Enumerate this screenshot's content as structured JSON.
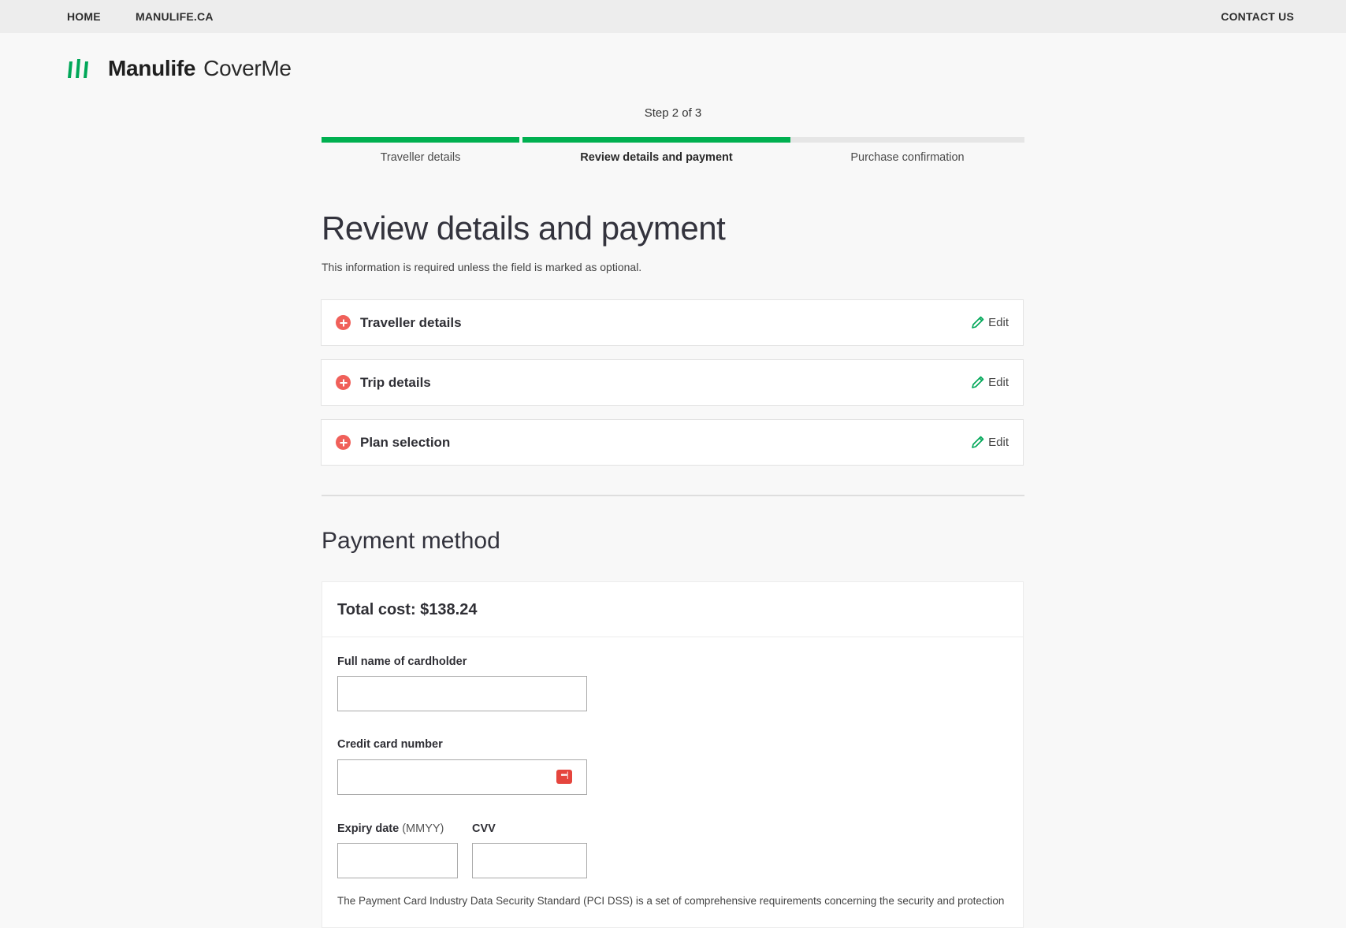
{
  "nav": {
    "home": "HOME",
    "manulife": "MANULIFE.CA",
    "contact": "CONTACT US"
  },
  "logo": {
    "brand": "Manulife",
    "product": "CoverMe",
    "icon": "manulife-logo-icon",
    "color": "#00a758"
  },
  "stepper": {
    "count": "Step 2 of 3",
    "steps": [
      {
        "label": "Traveller details",
        "status": "complete"
      },
      {
        "label": "Review details and payment",
        "status": "current"
      },
      {
        "label": "Purchase confirmation",
        "status": "upcoming"
      }
    ],
    "active_color": "#00b050"
  },
  "page": {
    "title": "Review details and payment",
    "subtitle": "This information is required unless the field is marked as optional."
  },
  "sections": [
    {
      "title": "Traveller details",
      "edit": "Edit",
      "icon": "plus-circle-icon"
    },
    {
      "title": "Trip details",
      "edit": "Edit",
      "icon": "plus-circle-icon"
    },
    {
      "title": "Plan selection",
      "edit": "Edit",
      "icon": "plus-circle-icon"
    }
  ],
  "payment": {
    "title": "Payment method",
    "total": "Total cost: $138.24",
    "cardholder_label": "Full name of cardholder",
    "cardholder_value": "",
    "card_number_label": "Credit card number",
    "card_number_value": "",
    "autofill_icon": "password-autofill-icon",
    "expiry_label": "Expiry date",
    "expiry_hint": "(MMYY)",
    "expiry_value": "",
    "cvv_label": "CVV",
    "cvv_value": "",
    "pci_text": "The Payment Card Industry Data Security Standard (PCI DSS) is a set of comprehensive requirements concerning the security and protection"
  },
  "colors": {
    "accent": "#00b050",
    "expand_icon": "#f0605a",
    "edit_icon": "#00a758"
  }
}
